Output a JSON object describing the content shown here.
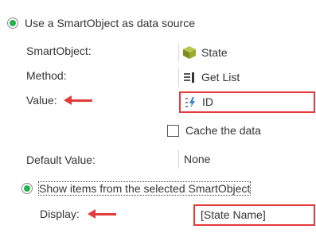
{
  "options": {
    "use_smartobject_label": "Use a SmartObject as data source",
    "smartobject": {
      "label": "SmartObject:",
      "value": "State"
    },
    "method": {
      "label": "Method:",
      "value": "Get List"
    },
    "value": {
      "label": "Value:",
      "value": "ID"
    },
    "cache": {
      "label": "Cache the data"
    },
    "default_value": {
      "label": "Default Value:",
      "value": "None"
    },
    "show_items_label": "Show items from the selected SmartObject",
    "display": {
      "label": "Display:",
      "value": "[State Name]"
    }
  },
  "colors": {
    "radio_selected": "#22b14c",
    "highlight": "#e43a3a"
  },
  "icons": {
    "smartobject": "cube-icon",
    "method": "list-method-icon",
    "value": "property-icon"
  }
}
